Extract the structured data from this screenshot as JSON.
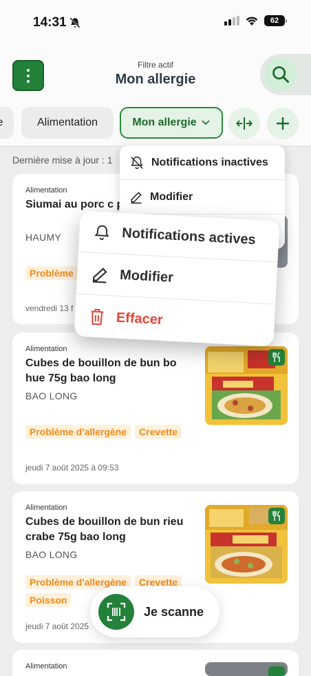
{
  "status_bar": {
    "time": "14:31",
    "battery": "62"
  },
  "header": {
    "subtitle": "Filtre actif",
    "title": "Mon allergie"
  },
  "filters": {
    "chip_partial": "e",
    "chip_alimentation": "Alimentation",
    "chip_active": "Mon allergie"
  },
  "last_update": "Dernière mise à jour : 1",
  "cards": [
    {
      "category": "Alimentation",
      "name": "Siumai au porc c pieces",
      "brand": "HAUMY",
      "tags": [
        "Problème"
      ],
      "date": "vendredi 13 f"
    },
    {
      "category": "Alimentation",
      "name": "Cubes de bouillon de bun bo hue 75g bao long",
      "brand": "BAO LONG",
      "tags": [
        "Problème d'allergène",
        "Crevette"
      ],
      "date": "jeudi 7 août 2025 à 09:53"
    },
    {
      "category": "Alimentation",
      "name": "Cubes de bouillon de bun rieu crabe 75g bao long",
      "brand": "BAO LONG",
      "tags": [
        "Problème d'allergène",
        "Crevette",
        "Poisson"
      ],
      "date": "jeudi 7 août 2025"
    },
    {
      "category": "Alimentation"
    }
  ],
  "dropdown_small": {
    "notifications": "Notifications inactives",
    "edit": "Modifier"
  },
  "context_menu": {
    "notifications": "Notifications actives",
    "edit": "Modifier",
    "delete": "Effacer"
  },
  "scan_button": {
    "label": "Je scanne"
  },
  "colors": {
    "brand_green": "#23813a",
    "tag_orange": "#ee8a1c",
    "tag_bg": "#fff1dc",
    "danger": "#e24638"
  }
}
